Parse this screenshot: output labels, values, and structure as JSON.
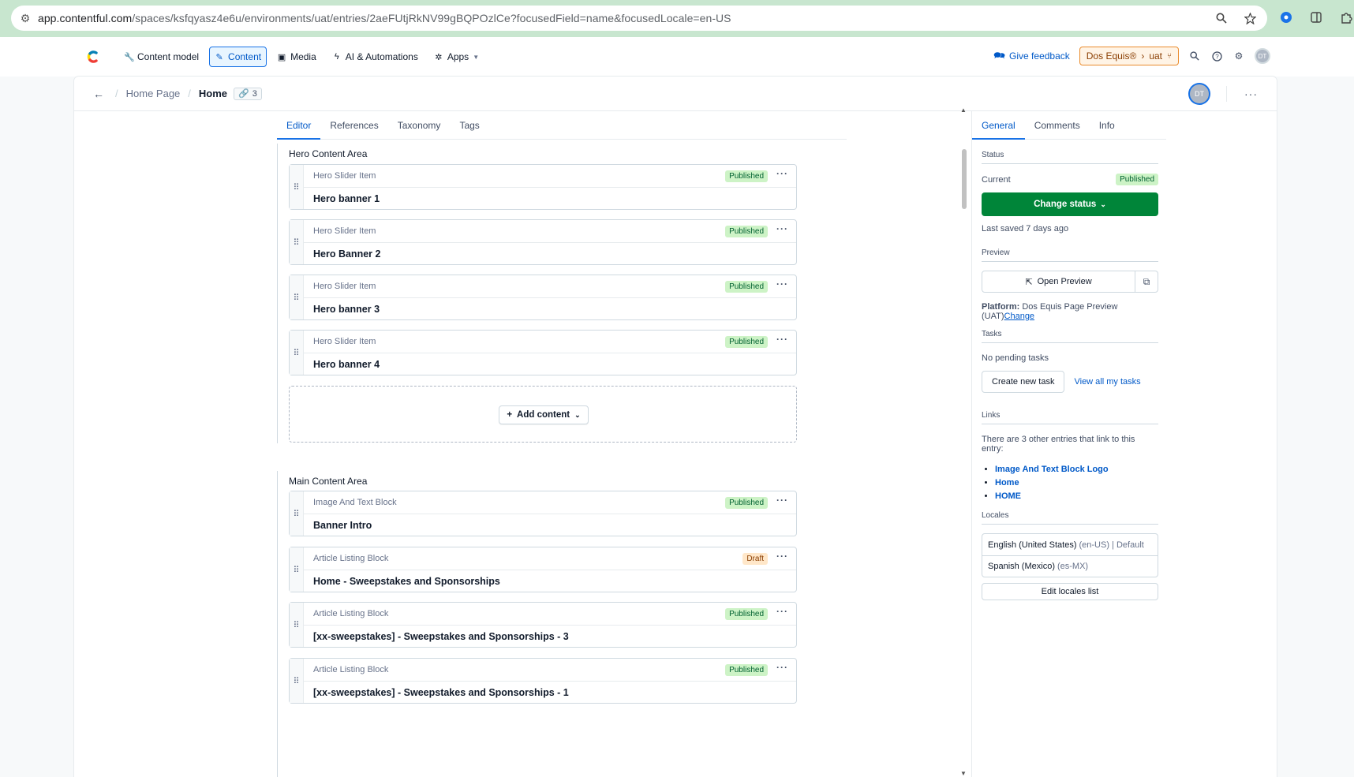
{
  "browser": {
    "url_host": "app.contentful.com",
    "url_path": "/spaces/ksfqyasz4e6u/environments/uat/entries/2aeFUtjRkNV99gBQPOzlCe?focusedField=name&focusedLocale=en-US"
  },
  "topnav": {
    "items": [
      {
        "label": "Content model",
        "icon": "wrench-icon"
      },
      {
        "label": "Content",
        "icon": "pencil-icon",
        "active": true
      },
      {
        "label": "Media",
        "icon": "image-icon"
      },
      {
        "label": "AI & Automations",
        "icon": "bolt-icon"
      },
      {
        "label": "Apps",
        "icon": "puzzle-icon"
      }
    ],
    "feedback": "Give feedback",
    "space": "Dos Equis®",
    "environment": "uat",
    "user_initials": "DT"
  },
  "entry_header": {
    "breadcrumb_parent": "Home Page",
    "title": "Home",
    "ref_count": "3"
  },
  "editor_tabs": [
    "Editor",
    "References",
    "Taxonomy",
    "Tags"
  ],
  "fields": [
    {
      "label": "Hero Content Area",
      "entries": [
        {
          "type": "Hero Slider Item",
          "title": "Hero banner 1",
          "status": "Published"
        },
        {
          "type": "Hero Slider Item",
          "title": "Hero Banner 2",
          "status": "Published"
        },
        {
          "type": "Hero Slider Item",
          "title": "Hero banner 3",
          "status": "Published"
        },
        {
          "type": "Hero Slider Item",
          "title": "Hero banner 4",
          "status": "Published"
        }
      ],
      "add_label": "Add content"
    },
    {
      "label": "Main Content Area",
      "entries": [
        {
          "type": "Image And Text Block",
          "title": "Banner Intro",
          "status": "Published"
        },
        {
          "type": "Article Listing Block",
          "title": "Home - Sweepstakes and Sponsorships",
          "status": "Draft"
        },
        {
          "type": "Article Listing Block",
          "title": "[xx-sweepstakes] - Sweepstakes and Sponsorships - 3",
          "status": "Published"
        },
        {
          "type": "Article Listing Block",
          "title": "[xx-sweepstakes] - Sweepstakes and Sponsorships - 1",
          "status": "Published"
        }
      ]
    }
  ],
  "sidebar": {
    "tabs": [
      "General",
      "Comments",
      "Info"
    ],
    "status_heading": "Status",
    "current_label": "Current",
    "current_status": "Published",
    "change_status": "Change status",
    "last_saved": "Last saved 7 days ago",
    "preview_heading": "Preview",
    "open_preview": "Open Preview",
    "platform_label": "Platform:",
    "platform_value": "Dos Equis Page Preview (UAT)",
    "platform_change": "Change",
    "tasks_heading": "Tasks",
    "no_tasks": "No pending tasks",
    "create_task": "Create new task",
    "view_tasks": "View all my tasks",
    "links_heading": "Links",
    "links_text": "There are 3 other entries that link to this entry:",
    "links": [
      "Image And Text Block Logo",
      "Home",
      "HOME"
    ],
    "locales_heading": "Locales",
    "locales": [
      {
        "name": "English (United States)",
        "detail": "(en-US) | Default"
      },
      {
        "name": "Spanish (Mexico)",
        "detail": "(es-MX)"
      }
    ],
    "edit_locales": "Edit locales list"
  },
  "colors": {
    "accent": "#1872e6",
    "published_bg": "#cdf3c6",
    "draft_bg": "#ffe7c9",
    "change_status_bg": "#008539"
  }
}
